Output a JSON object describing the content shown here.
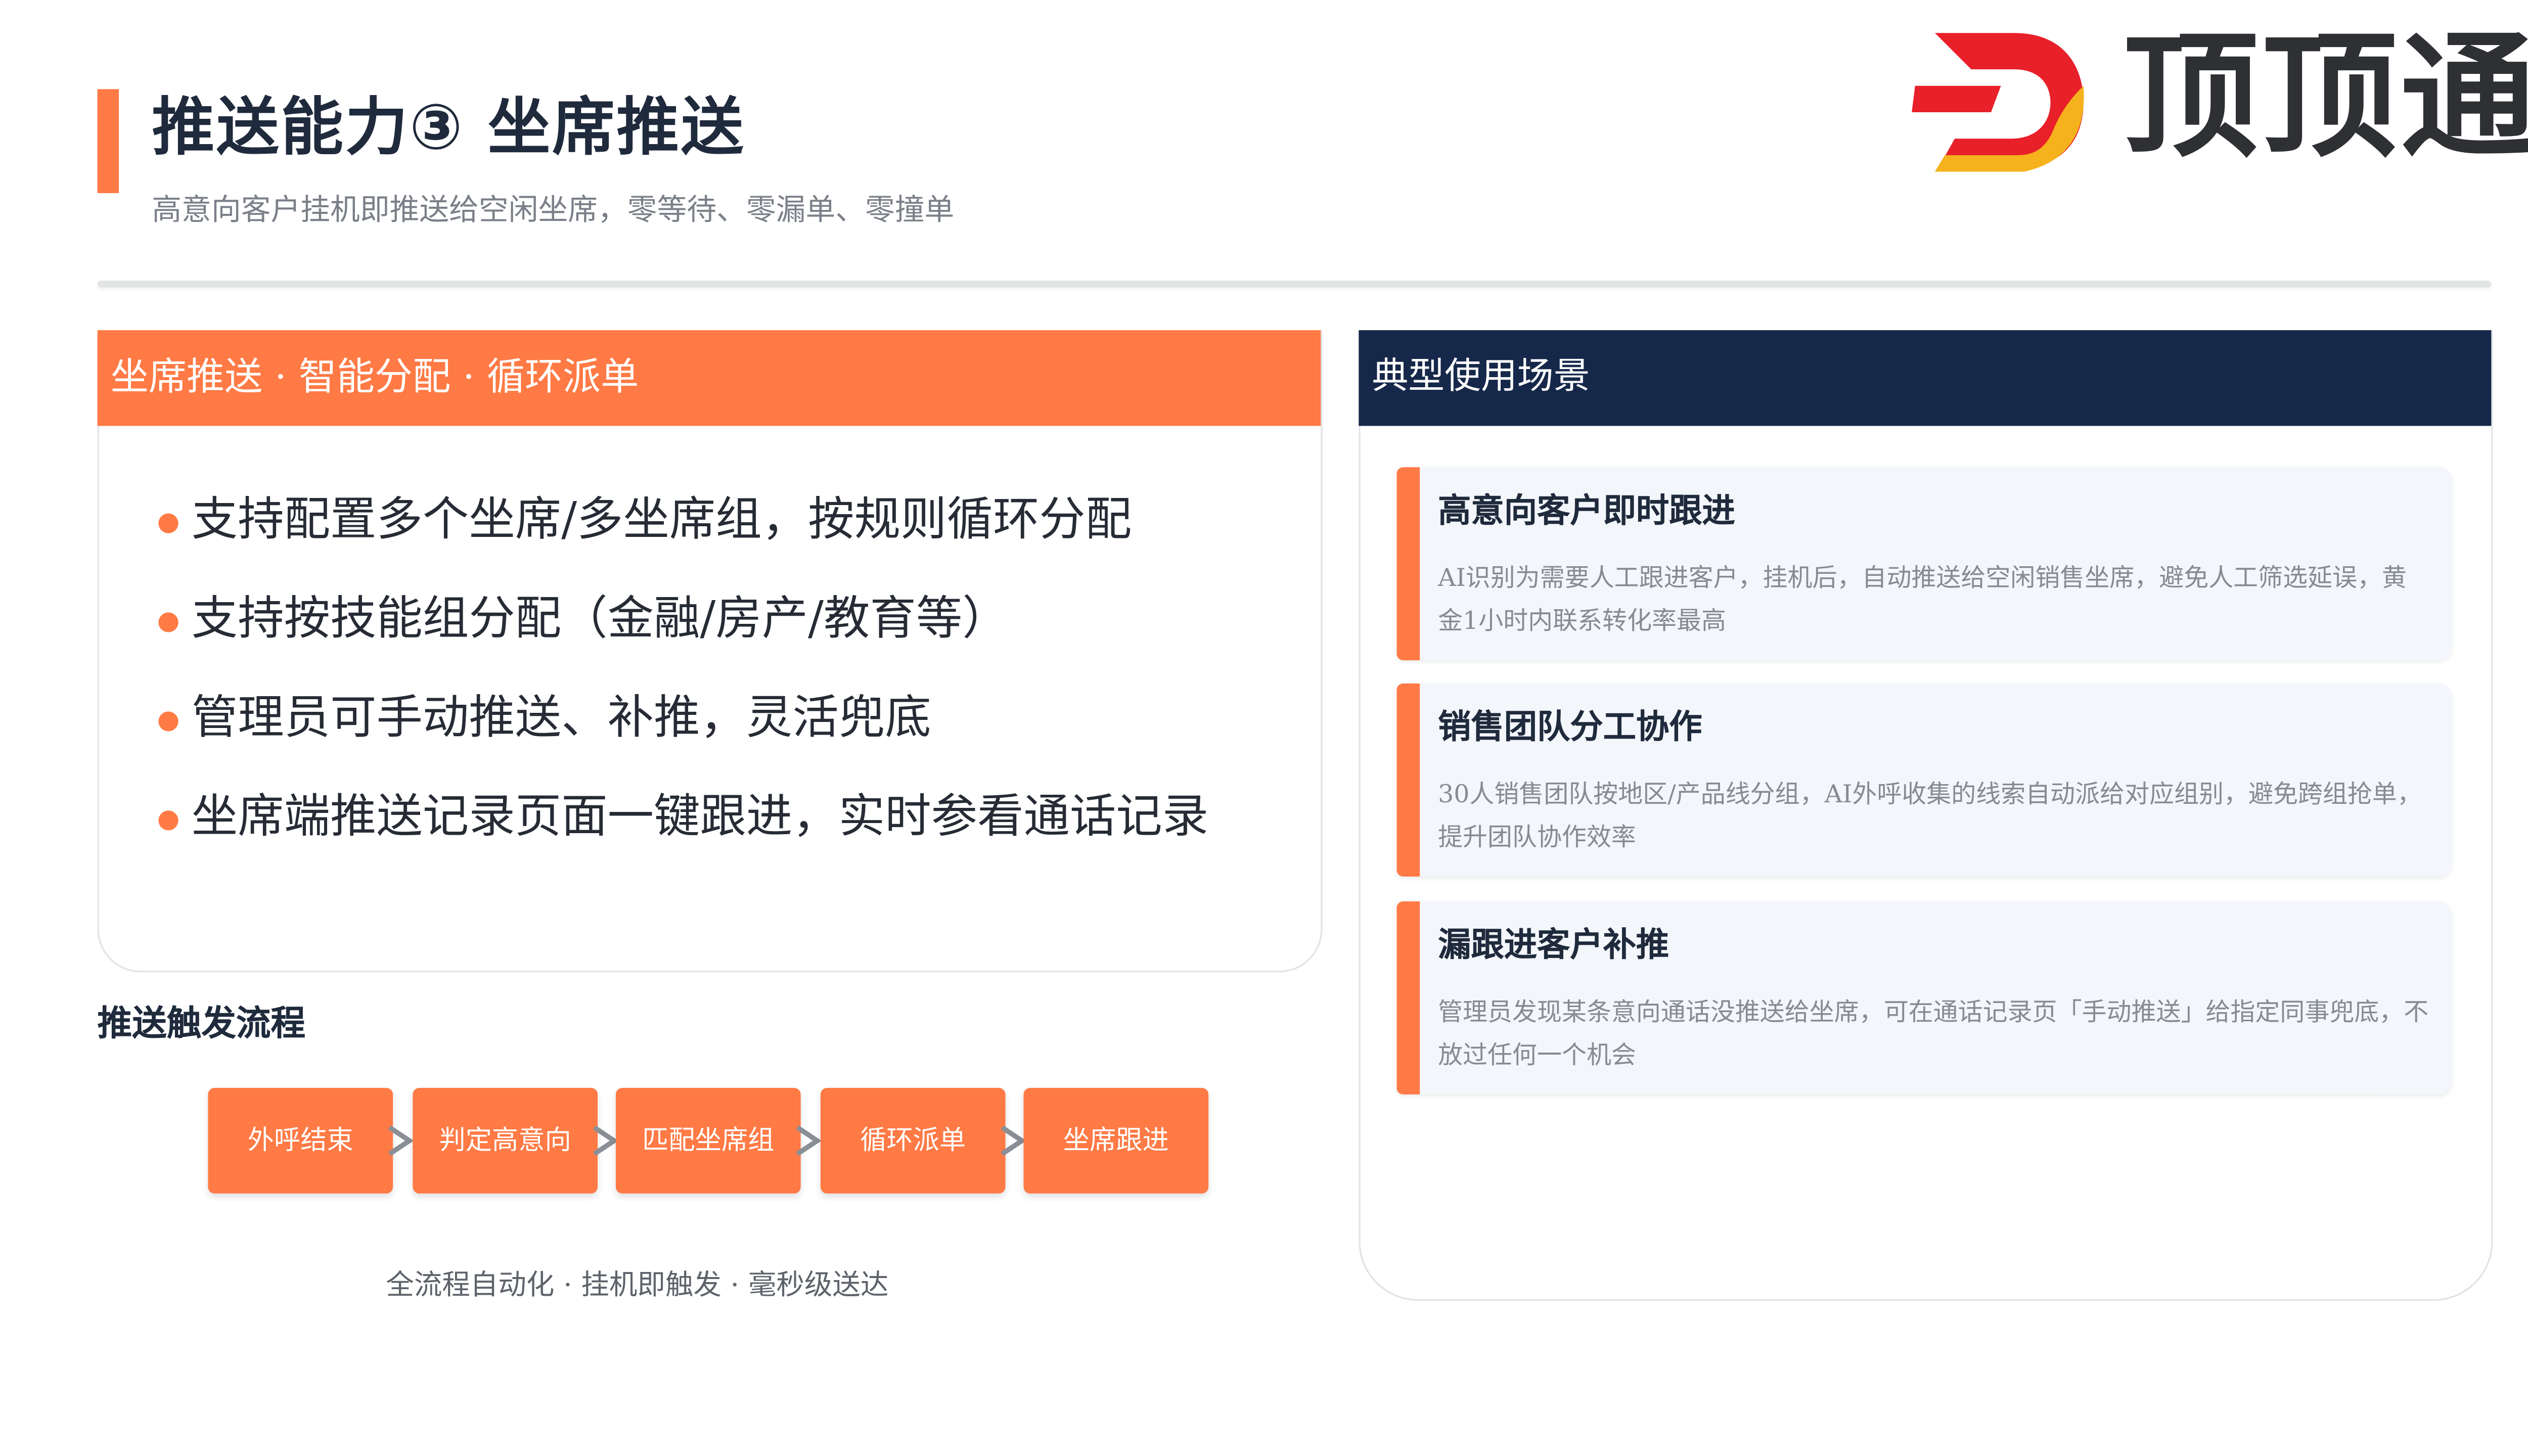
{
  "header": {
    "title": "推送能力③ 坐席推送",
    "subtitle": "高意向客户挂机即推送给空闲坐席，零等待、零漏单、零撞单"
  },
  "logo": {
    "text": "顶顶通",
    "icon": "dingdingtong-d-logo-icon",
    "colors": {
      "red": "#e8202a",
      "yellow": "#f5b21c"
    }
  },
  "left_panel": {
    "heading": "坐席推送 · 智能分配 · 循环派单",
    "bullets": [
      "支持配置多个坐席/多坐席组，按规则循环分配",
      "支持按技能组分配（金融/房产/教育等）",
      "管理员可手动推送、补推，灵活兜底",
      "坐席端推送记录页面一键跟进，实时参看通话记录"
    ]
  },
  "flow": {
    "title": "推送触发流程",
    "steps": [
      "外呼结束",
      "判定高意向",
      "匹配坐席组",
      "循环派单",
      "坐席跟进"
    ],
    "caption": "全流程自动化 · 挂机即触发 · 毫秒级送达"
  },
  "right_panel": {
    "heading": "典型使用场景",
    "cards": [
      {
        "title": "高意向客户即时跟进",
        "desc": "AI识别为需要人工跟进客户，挂机后，自动推送给空闲销售坐席，避免人工筛选延误，黄金1小时内联系转化率最高"
      },
      {
        "title": "销售团队分工协作",
        "desc": "30人销售团队按地区/产品线分组，AI外呼收集的线索自动派给对应组别，避免跨组抢单，提升团队协作效率"
      },
      {
        "title": "漏跟进客户补推",
        "desc": "管理员发现某条意向通话没推送给坐席，可在通话记录页「手动推送」给指定同事兜底，不放过任何一个机会"
      }
    ]
  },
  "colors": {
    "accent": "#ff7a45",
    "navy": "#16284a",
    "card_bg": "#f3f6fa"
  }
}
